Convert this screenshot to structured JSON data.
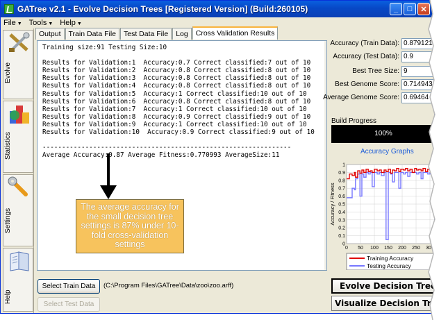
{
  "window": {
    "title": "GATree v2.1 - Evolve Decision Trees [Registered Version] (Build:260105)",
    "minimize_icon": "minimize-icon",
    "maximize_icon": "maximize-icon",
    "close_icon": "close-icon"
  },
  "menu": [
    {
      "label": "File"
    },
    {
      "label": "Tools"
    },
    {
      "label": "Help"
    }
  ],
  "sidebar": {
    "items": [
      {
        "label": "Evolve",
        "icon": "evolve-tools-icon"
      },
      {
        "label": "Statistics",
        "icon": "statistics-chart-icon"
      },
      {
        "label": "Settings",
        "icon": "wrench-icon"
      },
      {
        "label": "Help",
        "icon": "help-book-icon"
      }
    ]
  },
  "tabs": [
    {
      "label": "Output"
    },
    {
      "label": "Train Data File"
    },
    {
      "label": "Test Data File"
    },
    {
      "label": "Log"
    },
    {
      "label": "Cross Validation Results",
      "active": true
    }
  ],
  "results": {
    "lines": [
      "Training size:91 Testing Size:10",
      "",
      "Results for Validation:1  Accuracy:0.7 Correct classified:7 out of 10",
      "Results for Validation:2  Accuracy:0.8 Correct classified:8 out of 10",
      "Results for Validation:3  Accuracy:0.8 Correct classified:8 out of 10",
      "Results for Validation:4  Accuracy:0.8 Correct classified:8 out of 10",
      "Results for Validation:5  Accuracy:1 Correct classified:10 out of 10",
      "Results for Validation:6  Accuracy:0.8 Correct classified:8 out of 10",
      "Results for Validation:7  Accuracy:1 Correct classified:10 out of 10",
      "Results for Validation:8  Accuracy:0.9 Correct classified:9 out of 10",
      "Results for Validation:9  Accuracy:1 Correct classified:10 out of 10",
      "Results for Validation:10  Accuracy:0.9 Correct classified:9 out of 10",
      "",
      "----------------------------------------------------------------",
      "Average Accuracy:0.87 Average Fitness:0.770993 AverageSize:11"
    ]
  },
  "annotation": {
    "callout_text": "The average accuracy for the small decision tree settings is 87% under 10-fold cross-validation settings",
    "callout_color": "#f7c35d"
  },
  "files": {
    "select_train_label": "Select Train Data",
    "select_test_label": "Select Test Data",
    "train_path": "(C:\\Program Files\\GATree\\Data\\zoo\\zoo.arff)"
  },
  "stats": {
    "accuracy_train_label": "Accuracy (Train Data):",
    "accuracy_train_value": "0.879121",
    "accuracy_test_label": "Accuracy (Test Data):",
    "accuracy_test_value": "0.9",
    "best_tree_size_label": "Best Tree Size:",
    "best_tree_size_value": "9",
    "best_genome_label": "Best Genome Score:",
    "best_genome_value": "0.714943",
    "avg_genome_label": "Average Genome Score:",
    "avg_genome_value": "0.69464"
  },
  "build": {
    "label": "Build Progress",
    "progress_text": "100%",
    "progress_value": 1.0
  },
  "graphs": {
    "title": "Accuracy Graphs",
    "ylabel": "Accuracy / Fitness",
    "y_ticks": [
      "1",
      "0.9",
      "0.8",
      "0.7",
      "0.6",
      "0.5",
      "0.4",
      "0.3",
      "0.2",
      "0.1",
      "0"
    ],
    "x_ticks": [
      "0",
      "50",
      "100",
      "150",
      "200",
      "250",
      "300"
    ],
    "legend": [
      {
        "name": "Training Accuracy",
        "color": "#e00000"
      },
      {
        "name": "Testing Accuracy",
        "color": "#7777ff"
      }
    ]
  },
  "chart_data": {
    "type": "line",
    "ylabel": "Accuracy / Fitness",
    "ylim": [
      0,
      1
    ],
    "xlim": [
      0,
      320
    ],
    "x_ticks": [
      0,
      50,
      100,
      150,
      200,
      250,
      300
    ],
    "y_ticks": [
      0,
      0.1,
      0.2,
      0.3,
      0.4,
      0.5,
      0.6,
      0.7,
      0.8,
      0.9,
      1
    ],
    "grid": true,
    "legend_position": "bottom",
    "series": [
      {
        "name": "Training Accuracy",
        "color": "#e00000",
        "x": [
          0,
          10,
          20,
          28,
          32,
          40,
          48,
          55,
          62,
          70,
          78,
          85,
          92,
          100,
          110,
          118,
          125,
          135,
          142,
          150,
          158,
          165,
          172,
          180,
          188,
          195,
          205,
          212,
          220,
          228,
          236,
          245,
          252,
          260,
          268,
          275,
          284,
          292,
          300,
          310,
          320
        ],
        "y": [
          0.82,
          0.88,
          0.86,
          0.9,
          0.84,
          0.92,
          0.89,
          0.93,
          0.9,
          0.94,
          0.91,
          0.92,
          0.9,
          0.94,
          0.92,
          0.93,
          0.9,
          0.93,
          0.91,
          0.94,
          0.89,
          0.93,
          0.92,
          0.95,
          0.91,
          0.94,
          0.93,
          0.95,
          0.92,
          0.94,
          0.9,
          0.95,
          0.93,
          0.94,
          0.92,
          0.95,
          0.91,
          0.94,
          0.93,
          0.95,
          0.94
        ]
      },
      {
        "name": "Testing Accuracy",
        "color": "#7777ff",
        "x": [
          0,
          10,
          20,
          28,
          32,
          40,
          48,
          55,
          62,
          70,
          78,
          85,
          92,
          100,
          110,
          118,
          125,
          135,
          142,
          150,
          158,
          165,
          172,
          180,
          188,
          195,
          205,
          212,
          220,
          228,
          236,
          245,
          252,
          260,
          268,
          275,
          284,
          292,
          300,
          310,
          320
        ],
        "y": [
          0.58,
          0.58,
          0.7,
          0.68,
          0.82,
          0.88,
          0.6,
          0.88,
          0.84,
          0.9,
          0.88,
          0.9,
          0.72,
          0.9,
          0.88,
          0.9,
          0.86,
          0.9,
          0.05,
          0.9,
          0.88,
          0.78,
          0.9,
          0.9,
          0.7,
          0.9,
          0.88,
          0.9,
          0.85,
          0.9,
          0.9,
          0.9,
          0.88,
          0.9,
          0.82,
          0.9,
          0.9,
          0.88,
          0.9,
          0.88,
          0.9
        ]
      }
    ]
  },
  "actions": {
    "evolve_label": "Evolve Decision Trees",
    "visualize_label": "Visualize Decision Trees"
  }
}
